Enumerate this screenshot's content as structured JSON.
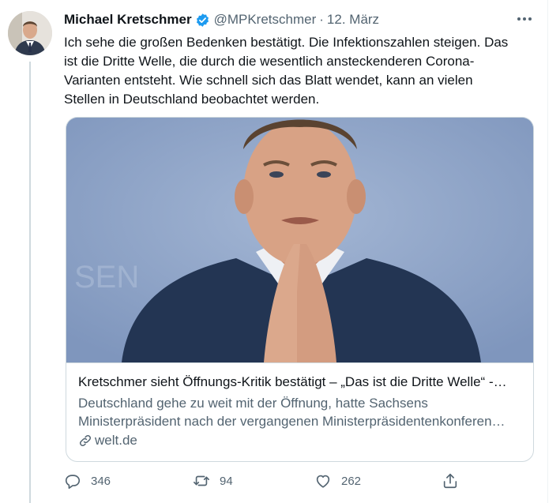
{
  "tweet": {
    "author": {
      "display_name": "Michael Kretschmer",
      "handle": "@MPKretschmer",
      "verified": true
    },
    "separator": "·",
    "date": "12. März",
    "text_lines": [
      "Ich sehe die großen Bedenken bestätigt. Die Infektionszahlen steigen. Das",
      "ist die Dritte Welle, die durch die wesentlich ansteckenderen Corona-",
      "Varianten entsteht. Wie schnell sich das Blatt wendet, kann an vielen",
      "Stellen in Deutschland beobachtet werden."
    ],
    "card": {
      "title": "Kretschmer sieht Öffnungs-Kritik bestätigt – „Das ist die Dritte Welle“ -…",
      "description_lines": [
        "Deutschland gehe zu weit mit der Öffnung, hatte Sachsens",
        "Ministerpräsident nach der vergangenen Ministerpräsidentenkonferen…"
      ],
      "domain": "welt.de"
    },
    "actions": {
      "replies": "346",
      "retweets": "94",
      "likes": "262"
    }
  },
  "colors": {
    "text_primary": "#0f1419",
    "text_secondary": "#536471",
    "verified_blue": "#1d9bf0",
    "border": "#cfd9de"
  },
  "icons": [
    "more-icon",
    "verified-icon",
    "link-icon",
    "reply-icon",
    "retweet-icon",
    "like-icon",
    "share-icon"
  ]
}
